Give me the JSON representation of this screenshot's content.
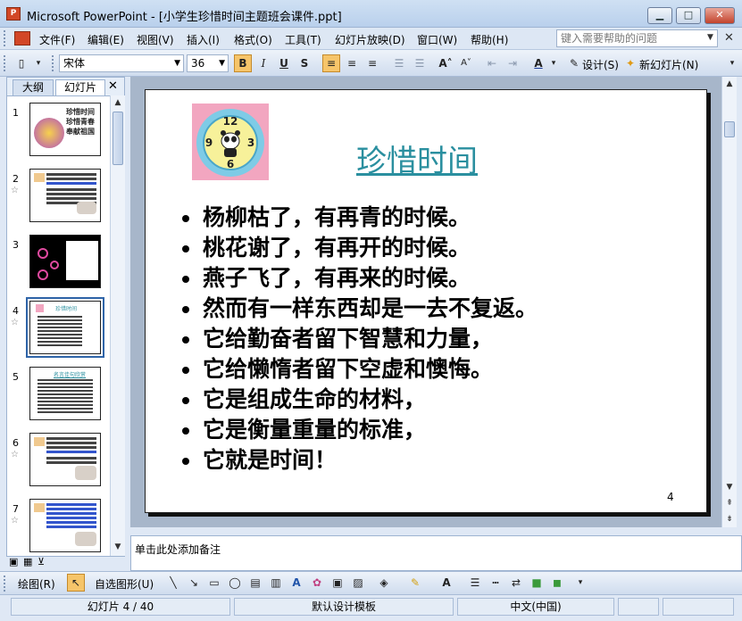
{
  "window": {
    "title": "Microsoft PowerPoint - [小学生珍惜时间主题班会课件.ppt]",
    "app_icon_label": "P"
  },
  "menubar": {
    "items": [
      "文件(F)",
      "编辑(E)",
      "视图(V)",
      "插入(I)",
      "格式(O)",
      "工具(T)",
      "幻灯片放映(D)",
      "窗口(W)",
      "帮助(H)"
    ],
    "help_placeholder": "键入需要帮助的问题"
  },
  "toolbar": {
    "font_name": "宋体",
    "font_size": "36",
    "bold": "B",
    "italic": "I",
    "underline": "U",
    "shadow": "S",
    "design_label": "设计(S)",
    "new_slide_label": "新幻灯片(N)"
  },
  "left_panel": {
    "tabs": [
      "大纲",
      "幻灯片"
    ],
    "selected_slide": 4,
    "slide_numbers": [
      "1",
      "2",
      "3",
      "4",
      "5",
      "6",
      "7"
    ],
    "thumb_title_slide1": "珍惜时间 珍惜青春 奉献祖国",
    "thumb_title_slide4": "珍惜时间",
    "thumb_title_slide5": "名言佳句欣赏"
  },
  "slide": {
    "title": "珍惜时间",
    "bullets": [
      "杨柳枯了，有再青的时候。",
      "桃花谢了，有再开的时候。",
      "燕子飞了，有再来的时候。",
      "然而有一样东西却是一去不复返。",
      "它给勤奋者留下智慧和力量，",
      "它给懒惰者留下空虚和懊悔。",
      "它是组成生命的材料，",
      "它是衡量重量的标准，",
      "它就是时间！"
    ],
    "page_number": "4",
    "clock_numbers": [
      "12",
      "3",
      "6",
      "9"
    ]
  },
  "notes": {
    "placeholder": "单击此处添加备注"
  },
  "drawing_toolbar": {
    "draw_label": "绘图(R)",
    "autoshapes_label": "自选图形(U)"
  },
  "statusbar": {
    "slide_position": "幻灯片 4 / 40",
    "template": "默认设计模板",
    "language": "中文(中国)"
  },
  "colors": {
    "title_color": "#2a8f9f",
    "accent_toolbar": "#f6c56a",
    "selected_thumb_border": "#2f64a8"
  }
}
